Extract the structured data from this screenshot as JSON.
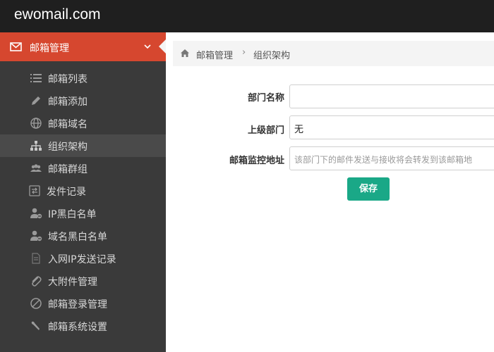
{
  "app": {
    "brand": "ewomail.com"
  },
  "sidebar": {
    "section_label": "邮箱管理",
    "items": [
      {
        "label": "邮箱列表",
        "icon": "list-icon"
      },
      {
        "label": "邮箱添加",
        "icon": "pencil-icon"
      },
      {
        "label": "邮箱域名",
        "icon": "globe-icon"
      },
      {
        "label": "组织架构",
        "icon": "sitemap-icon",
        "active": true
      },
      {
        "label": "邮箱群组",
        "icon": "group-icon"
      },
      {
        "label": "发件记录",
        "icon": "record-icon"
      },
      {
        "label": "IP黑白名单",
        "icon": "user-block-icon"
      },
      {
        "label": "域名黑白名单",
        "icon": "user-block-icon"
      },
      {
        "label": "入网IP发送记录",
        "icon": "document-icon"
      },
      {
        "label": "大附件管理",
        "icon": "paperclip-icon"
      },
      {
        "label": "邮箱登录管理",
        "icon": "ban-icon"
      },
      {
        "label": "邮箱系统设置",
        "icon": "wrench-icon"
      }
    ]
  },
  "breadcrumb": {
    "parent": "邮箱管理",
    "separator": "›",
    "current": "组织架构"
  },
  "form": {
    "dept_name": {
      "label": "部门名称",
      "value": ""
    },
    "parent_dept": {
      "label": "上级部门",
      "value": "无"
    },
    "monitor_address": {
      "label": "邮箱监控地址",
      "placeholder": "该部门下的邮件发送与接收将会转发到该邮箱地"
    },
    "save_label": "保存"
  },
  "colors": {
    "topbar": "#1f1f1f",
    "sidebar": "#3a3a3a",
    "accent": "#d6472f",
    "save_button": "#1aa887"
  }
}
